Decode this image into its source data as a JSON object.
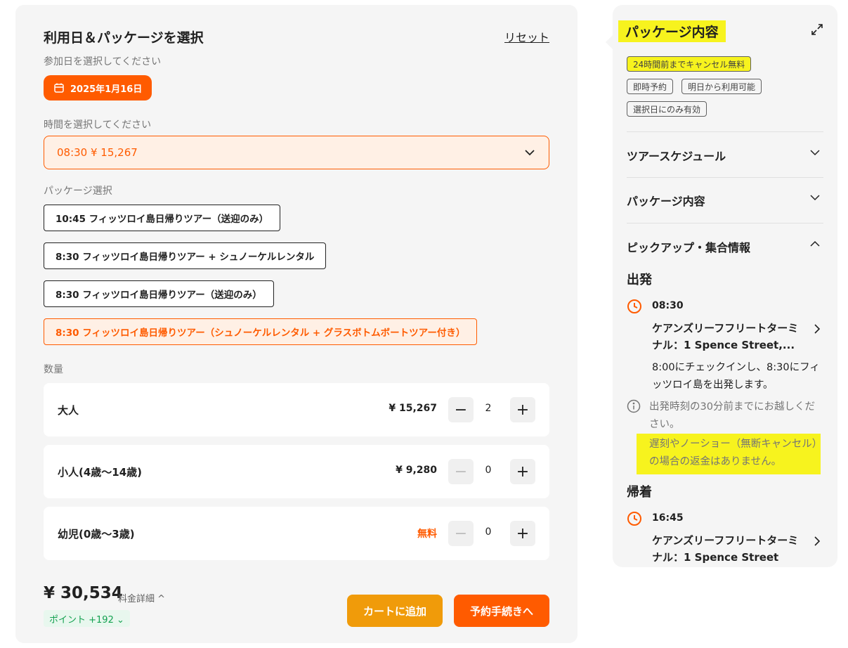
{
  "left": {
    "title": "利用日＆パッケージを選択",
    "reset": "リセット",
    "date_label": "参加日を選択してください",
    "date_value": "2025年1月16日",
    "time_label": "時間を選択してください",
    "time_value": "08:30 ¥ 15,267",
    "package_label": "パッケージ選択",
    "packages": [
      "10:45 フィッツロイ島日帰りツアー（送迎のみ）",
      "8:30 フィッツロイ島日帰りツアー + シュノーケルレンタル",
      "8:30 フィッツロイ島日帰りツアー（送迎のみ）",
      "8:30 フィッツロイ島日帰りツアー（シュノーケルレンタル + グラスボトムボートツアー付き）"
    ],
    "qty_label": "数量",
    "quantities": [
      {
        "label": "大人",
        "price": "¥ 15,267",
        "count": "2"
      },
      {
        "label": "小人(4歳〜14歳)",
        "price": "¥ 9,280",
        "count": "0"
      },
      {
        "label": "幼児(0歳〜3歳)",
        "price": "無料",
        "count": "0"
      }
    ],
    "total": "¥ 30,534",
    "fee_detail": "料金詳細 ^",
    "points": "ポイント +192 ⌄",
    "cart_button": "カートに追加",
    "book_button": "予約手続きへ"
  },
  "right": {
    "title": "パッケージ内容",
    "tags": [
      "24時間前までキャンセル無料",
      "即時予約",
      "明日から利用可能",
      "選択日にのみ有効"
    ],
    "accordions": [
      "ツアースケジュール",
      "パッケージ内容",
      "ピックアップ・集合情報"
    ],
    "departure_heading": "出発",
    "departure_time": "08:30",
    "departure_location": "ケアンズリーフフリートターミナル：1 Spence Street,...",
    "departure_desc": "8:00にチェックインし、8:30にフィッツロイ島を出発します。",
    "note1": "出発時刻の30分前までにお越しください。",
    "note2": "遅刻やノーショー（無断キャンセル）の場合の返金はありません。",
    "return_heading": "帰着",
    "return_time": "16:45",
    "return_location": "ケアンズリーフフリートターミナル：1 Spence Street"
  },
  "colors": {
    "accent": "#ff5b00",
    "cart": "#f09b0a",
    "highlight": "#f7f31e",
    "points": "#13a150"
  }
}
